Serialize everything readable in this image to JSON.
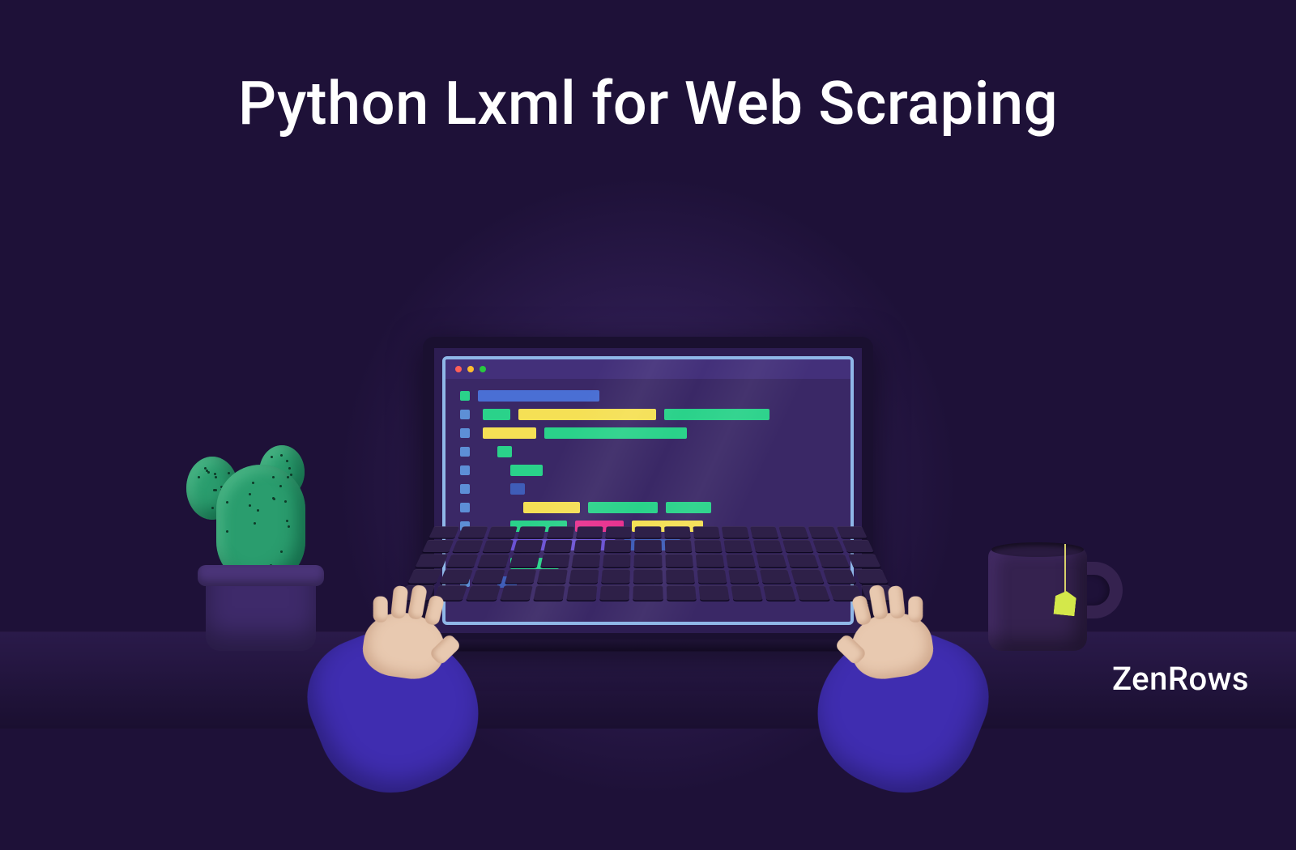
{
  "title": "Python Lxml for Web Scraping",
  "brand": "ZenRows",
  "colors": {
    "bg": "#1e1138",
    "accent_purple": "#3f2db0",
    "code_green": "#2ad28a",
    "code_yellow": "#f5e055",
    "code_pink": "#e8318f",
    "code_blue": "#4a6fd4",
    "cactus": "#2a9d6e",
    "tea_tag": "#d4e84a"
  },
  "illustration": {
    "elements": [
      "laptop",
      "code-editor",
      "hands-typing",
      "cactus-in-pot",
      "mug-with-teabag"
    ],
    "window_dots": [
      "red",
      "yellow",
      "green"
    ]
  }
}
